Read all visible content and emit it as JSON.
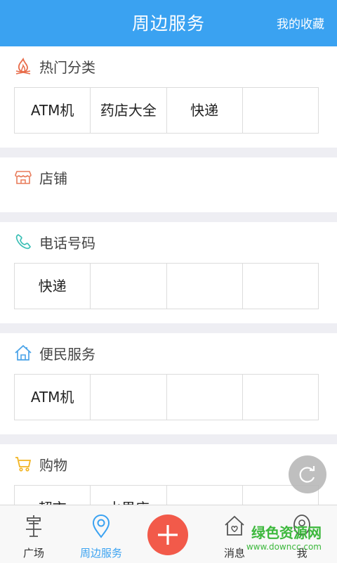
{
  "header": {
    "title": "周边服务",
    "favorites": "我的收藏"
  },
  "sections": [
    {
      "label": "热门分类",
      "icon": "fire-icon",
      "color": "#e86c4a",
      "cells": [
        "ATM机",
        "药店大全",
        "快递",
        ""
      ]
    },
    {
      "label": "店铺",
      "icon": "store-icon",
      "color": "#e87b5a",
      "cells": []
    },
    {
      "label": "电话号码",
      "icon": "phone-icon",
      "color": "#3bbfb5",
      "cells": [
        "快递",
        "",
        "",
        ""
      ]
    },
    {
      "label": "便民服务",
      "icon": "home-icon",
      "color": "#4aa3e8",
      "cells": [
        "ATM机",
        "",
        "",
        ""
      ]
    },
    {
      "label": "购物",
      "icon": "cart-icon",
      "color": "#f2b422",
      "cells": [
        "超市",
        "水果店",
        "",
        ""
      ]
    }
  ],
  "tabs": [
    {
      "label": "广场",
      "icon": "plaza-icon",
      "active": false
    },
    {
      "label": "周边服务",
      "icon": "location-pin-icon",
      "active": true
    },
    {
      "label": "",
      "icon": "plus-icon",
      "active": false
    },
    {
      "label": "消息",
      "icon": "message-home-icon",
      "active": false
    },
    {
      "label": "我",
      "icon": "user-icon",
      "active": false
    }
  ],
  "watermark": {
    "main": "绿色资源网",
    "sub": "www.downcc.com"
  },
  "colors": {
    "accent": "#3aa2f1",
    "plus": "#f25a4a",
    "separator": "#eeeef3"
  }
}
